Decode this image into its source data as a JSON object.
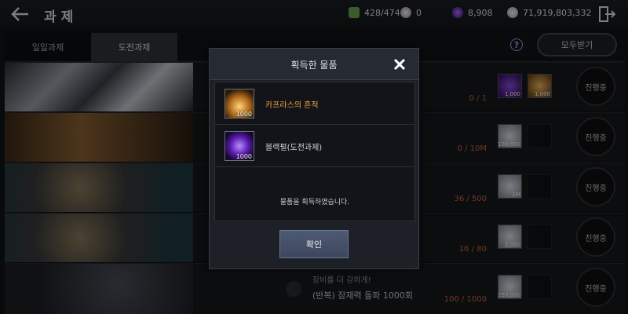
{
  "header": {
    "title": "과제",
    "resources": [
      {
        "name": "stamina",
        "value": "428/474",
        "color": "#6aa84f"
      },
      {
        "name": "pearl",
        "value": "0",
        "color": "#b9b9b9"
      },
      {
        "name": "black-pearl",
        "value": "8,908",
        "color": "#7b2fd1"
      },
      {
        "name": "silver",
        "value": "71,919,803,332",
        "color": "#c9ced6"
      }
    ]
  },
  "tabs": [
    {
      "label": "일일과제",
      "active": false
    },
    {
      "label": "도전과제",
      "active": true
    }
  ],
  "claim_all_label": "모두받기",
  "help_glyph": "?",
  "rows": [
    {
      "desc1": "",
      "desc2": "",
      "progress": "0 / 1",
      "status": "진행중",
      "rewards": [
        "1,000",
        "1,000"
      ]
    },
    {
      "desc1": "",
      "desc2": "",
      "progress": "0 / 10M",
      "status": "진행중",
      "rewards": [
        "100,000"
      ]
    },
    {
      "desc1": "",
      "desc2": "",
      "progress": "36 / 500",
      "status": "진행중",
      "rewards": [
        "1M"
      ]
    },
    {
      "desc1": "",
      "desc2": "",
      "progress": "16 / 80",
      "status": "진행중",
      "rewards": [
        "2,000"
      ]
    },
    {
      "desc1": "장비를 더 강하게!",
      "desc2": "(반복) 잠재력 돌파 1000회",
      "progress": "100 / 1000",
      "status": "진행중",
      "rewards": [
        "250,000"
      ]
    }
  ],
  "modal": {
    "title": "획득한 물품",
    "items": [
      {
        "name": "카프라스의 흔적",
        "count": "1000",
        "color": "#f0a63c"
      },
      {
        "name": "블랙펄(도전과제)",
        "count": "1000",
        "color": "#d6d6d6"
      }
    ],
    "notice": "물품을 획득하였습니다.",
    "confirm_label": "확인"
  }
}
